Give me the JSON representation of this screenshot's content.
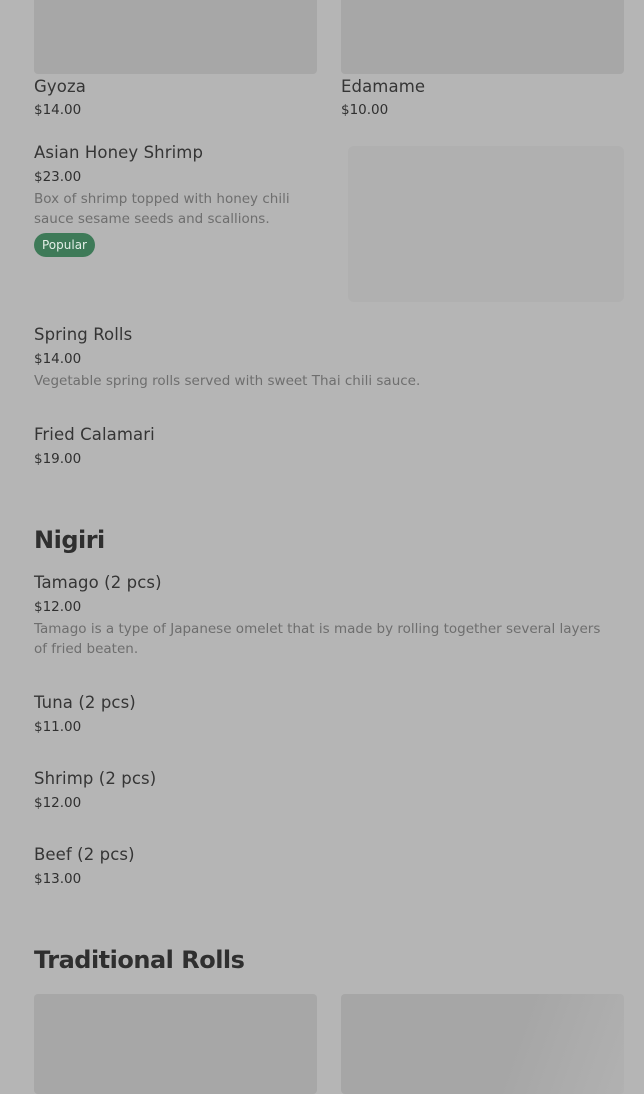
{
  "appetizers": {
    "tiles": [
      {
        "name": "Gyoza",
        "price": "$14.00"
      },
      {
        "name": "Edamame",
        "price": "$10.00"
      }
    ],
    "items": [
      {
        "name": "Asian Honey Shrimp",
        "price": "$23.00",
        "description": "Box of shrimp topped with honey chili sauce sesame seeds and scallions.",
        "badge": "Popular"
      },
      {
        "name": "Spring Rolls",
        "price": "$14.00",
        "description": "Vegetable spring rolls served with sweet Thai chili sauce."
      },
      {
        "name": "Fried Calamari",
        "price": "$19.00"
      }
    ]
  },
  "nigiri": {
    "title": "Nigiri",
    "items": [
      {
        "name": "Tamago (2 pcs)",
        "price": "$12.00",
        "description": "Tamago is a type of Japanese omelet that is made by rolling together several layers of fried beaten."
      },
      {
        "name": "Tuna (2 pcs)",
        "price": "$11.00"
      },
      {
        "name": "Shrimp (2 pcs)",
        "price": "$12.00"
      },
      {
        "name": "Beef (2 pcs)",
        "price": "$13.00"
      }
    ]
  },
  "traditional_rolls": {
    "title": "Traditional Rolls"
  }
}
